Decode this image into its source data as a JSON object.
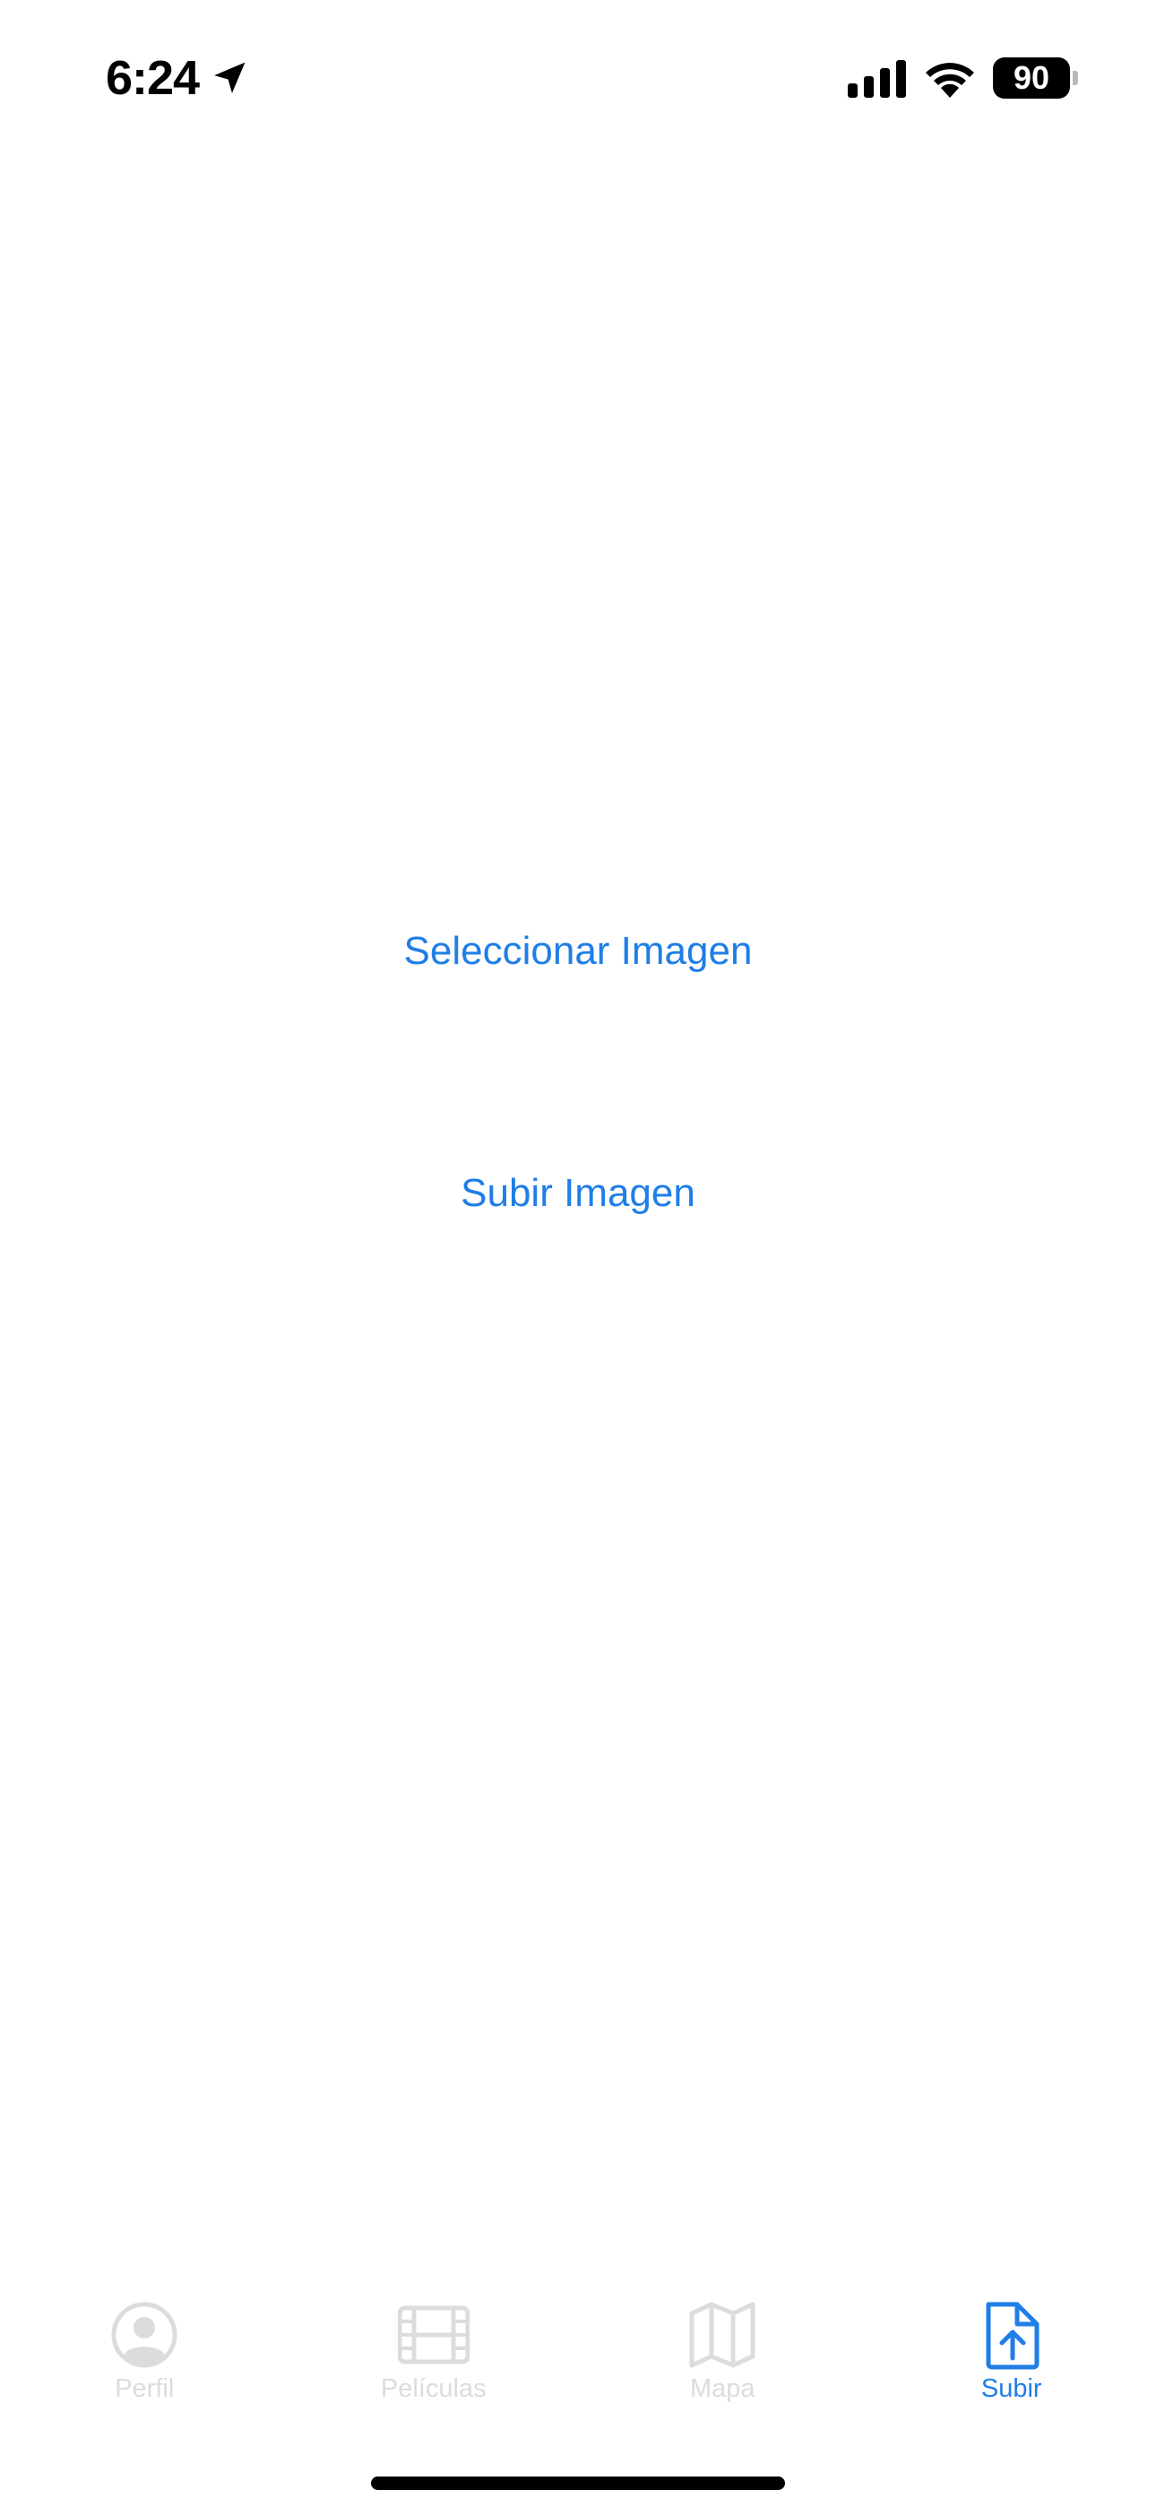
{
  "status_bar": {
    "time": "6:24",
    "battery_level": "90",
    "icons": [
      "location-arrow-icon",
      "cellular-signal-icon",
      "wifi-icon",
      "battery-icon"
    ]
  },
  "main": {
    "select_image_label": "Seleccionar Imagen",
    "upload_image_label": "Subir Imagen"
  },
  "tab_bar": {
    "active_color": "#1f7ee7",
    "inactive_color": "#dcdcdc",
    "items": [
      {
        "label": "Perfil",
        "icon": "person-circle-icon",
        "active": false
      },
      {
        "label": "Películas",
        "icon": "film-icon",
        "active": false
      },
      {
        "label": "Mapa",
        "icon": "map-icon",
        "active": false
      },
      {
        "label": "Subir",
        "icon": "document-upload-icon",
        "active": true
      }
    ]
  }
}
